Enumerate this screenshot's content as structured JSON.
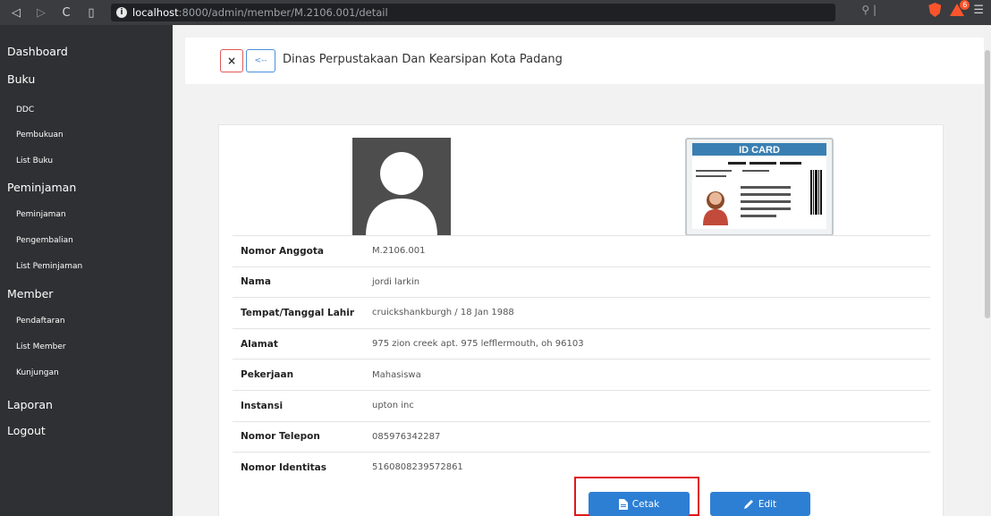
{
  "browser": {
    "url_host": "localhost",
    "url_path": ":8000/admin/member/M.2106.001/detail",
    "ext_badge": "6"
  },
  "sidebar": {
    "dashboard": "Dashboard",
    "buku": "Buku",
    "buku_items": [
      "DDC",
      "Pembukuan",
      "List Buku"
    ],
    "peminjaman": "Peminjaman",
    "peminjaman_items": [
      "Peminjaman",
      "Pengembalian",
      "List Peminjaman"
    ],
    "member": "Member",
    "member_items": [
      "Pendaftaran",
      "List Member",
      "Kunjungan"
    ],
    "laporan": "Laporan",
    "logout": "Logout"
  },
  "header": {
    "close_label": "×",
    "back_label": "<--",
    "title": "Dinas Perpustakaan Dan Kearsipan Kota Padang"
  },
  "id_card": {
    "title": "ID CARD"
  },
  "details": {
    "rows": [
      {
        "label": "Nomor Anggota",
        "value": "M.2106.001"
      },
      {
        "label": "Nama",
        "value": "jordi larkin"
      },
      {
        "label": "Tempat/Tanggal Lahir",
        "value": "cruickshankburgh / 18 Jan 1988"
      },
      {
        "label": "Alamat",
        "value": "975 zion creek apt. 975 lefflermouth, oh 96103"
      },
      {
        "label": "Pekerjaan",
        "value": "Mahasiswa"
      },
      {
        "label": "Instansi",
        "value": "upton inc"
      },
      {
        "label": "Nomor Telepon",
        "value": "085976342287"
      },
      {
        "label": "Nomor Identitas",
        "value": "5160808239572861"
      }
    ]
  },
  "actions": {
    "cetak_label": "Cetak",
    "edit_label": "Edit"
  },
  "colors": {
    "sidebar_bg": "#2f3033",
    "primary": "#2d7fd4",
    "highlight": "#e01818"
  }
}
